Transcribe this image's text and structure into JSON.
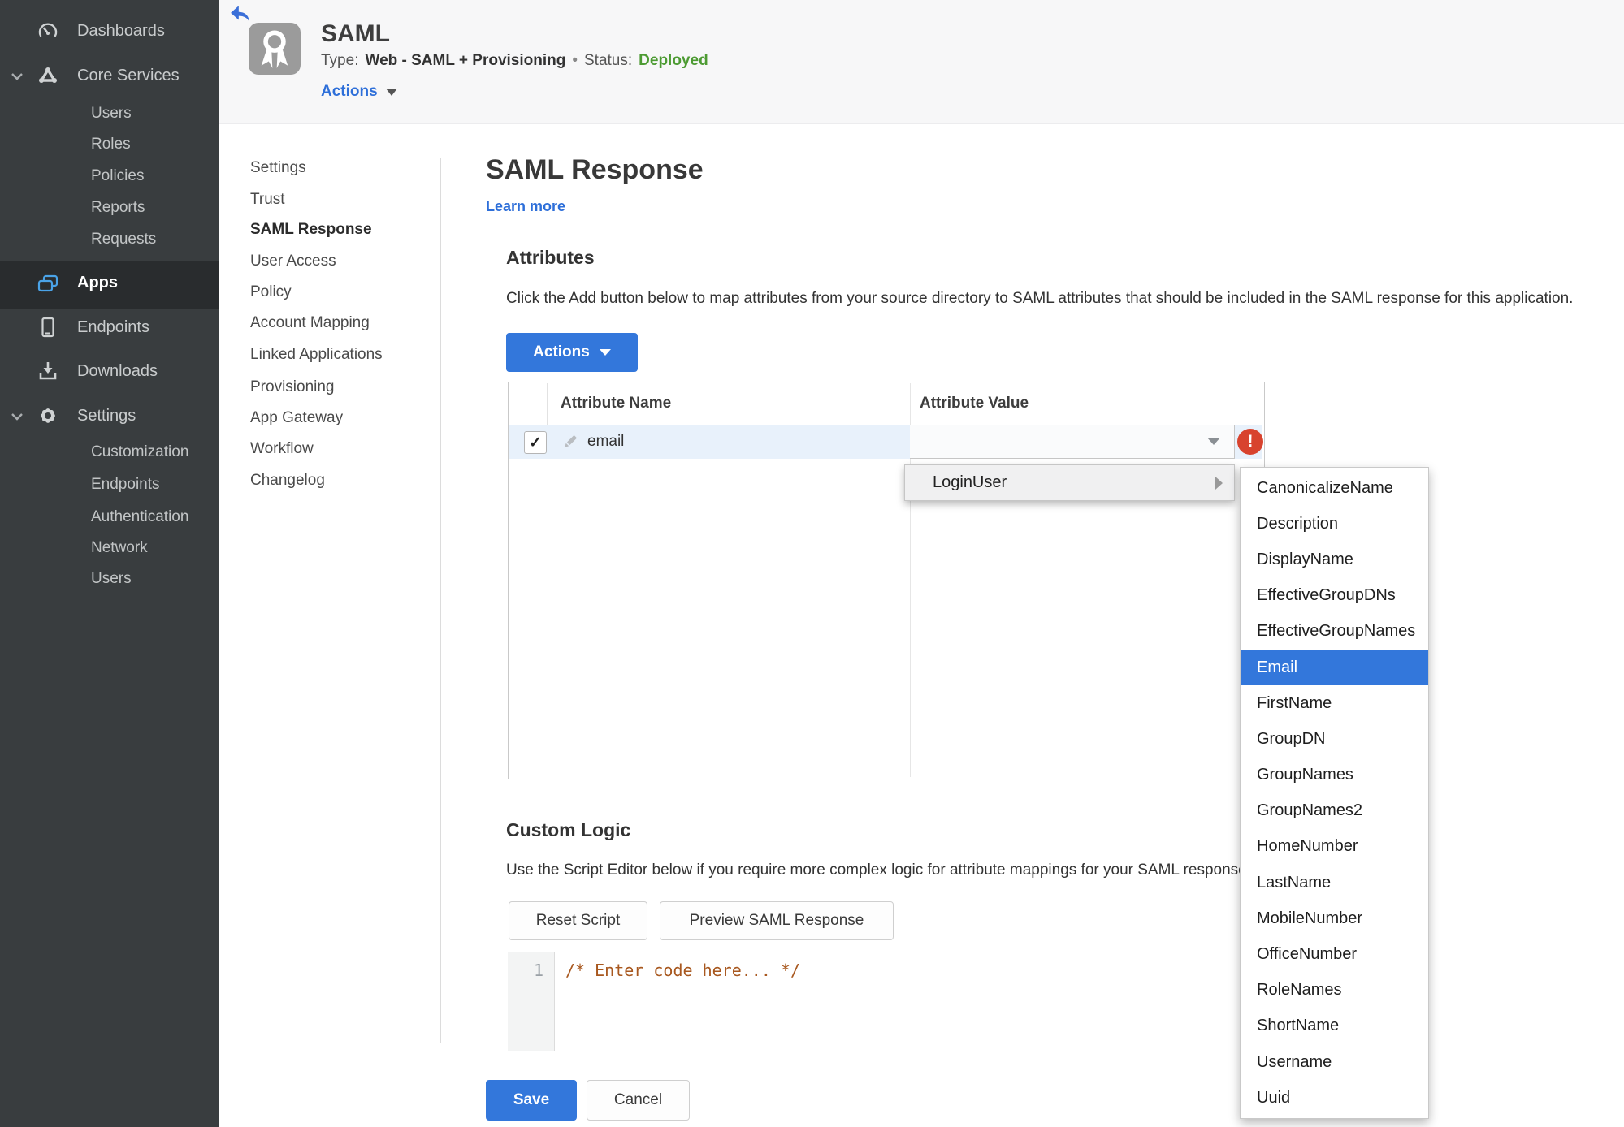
{
  "app": {
    "title": "SAML",
    "type_label": "Type:",
    "type_value": "Web - SAML + Provisioning",
    "dot": "•",
    "status_label": "Status:",
    "status_value": "Deployed",
    "actions_label": "Actions"
  },
  "sidebar": {
    "dashboards": "Dashboards",
    "core_services": "Core Services",
    "core_children": [
      "Users",
      "Roles",
      "Policies",
      "Reports",
      "Requests"
    ],
    "apps": "Apps",
    "endpoints": "Endpoints",
    "downloads": "Downloads",
    "settings": "Settings",
    "settings_children": [
      "Customization",
      "Endpoints",
      "Authentication",
      "Network",
      "Users"
    ]
  },
  "subnav": {
    "items": [
      "Settings",
      "Trust",
      "SAML Response",
      "User Access",
      "Policy",
      "Account Mapping",
      "Linked Applications",
      "Provisioning",
      "App Gateway",
      "Workflow",
      "Changelog"
    ],
    "active": "SAML Response"
  },
  "main": {
    "title": "SAML Response",
    "learn_more": "Learn more",
    "attributes": {
      "heading": "Attributes",
      "description": "Click the Add button below to map attributes from your source directory to SAML attributes that should be included in the SAML response for this application.",
      "actions_button": "Actions",
      "table": {
        "columns": [
          "Attribute Name",
          "Attribute Value"
        ],
        "rows": [
          {
            "name": "email",
            "value": "",
            "checked": true
          }
        ]
      }
    },
    "custom_logic": {
      "heading": "Custom Logic",
      "description": "Use the Script Editor below if you require more complex logic for attribute mappings for your SAML response.",
      "reset_button": "Reset Script",
      "preview_button": "Preview SAML Response",
      "editor": {
        "line_number": "1",
        "code": "/* Enter code here... */"
      }
    },
    "save_button": "Save",
    "cancel_button": "Cancel"
  },
  "context_menu": {
    "label": "LoginUser"
  },
  "attribute_menu": {
    "items": [
      "CanonicalizeName",
      "Description",
      "DisplayName",
      "EffectiveGroupDNs",
      "EffectiveGroupNames",
      "Email",
      "FirstName",
      "GroupDN",
      "GroupNames",
      "GroupNames2",
      "HomeNumber",
      "LastName",
      "MobileNumber",
      "OfficeNumber",
      "RoleNames",
      "ShortName",
      "Username",
      "Uuid"
    ],
    "selected": "Email"
  },
  "colors": {
    "accent_blue": "#3377db",
    "status_green": "#4d9b33",
    "error_red": "#d8432e",
    "sidebar_bg": "#393d3f"
  }
}
